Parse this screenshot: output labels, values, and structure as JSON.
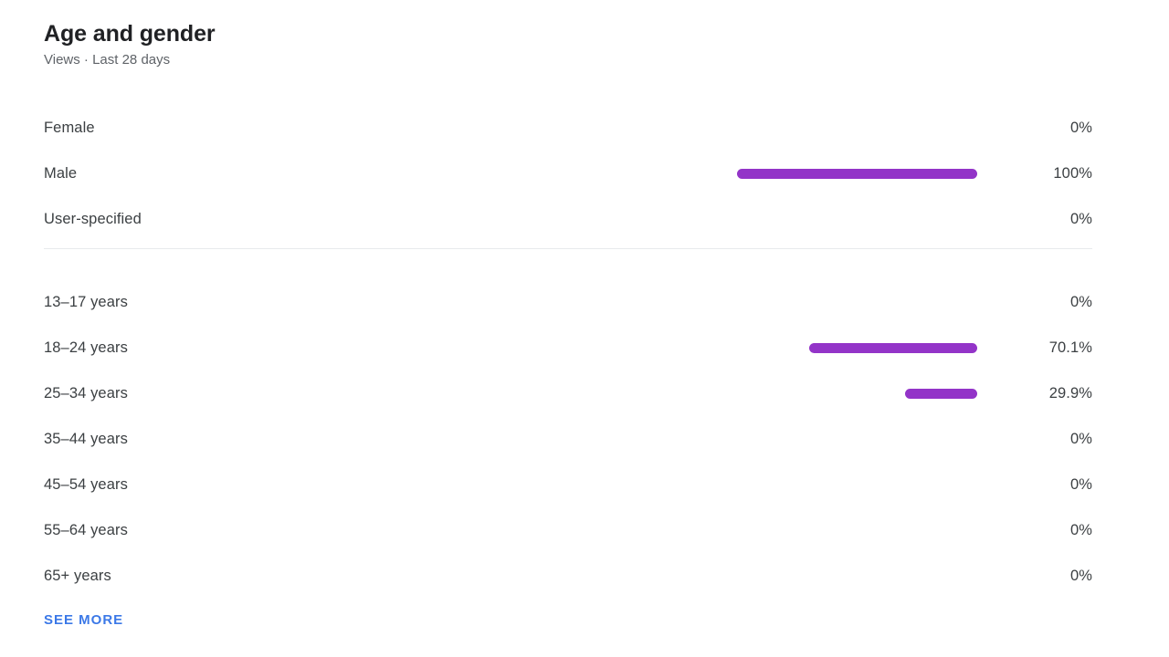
{
  "header": {
    "title": "Age and gender",
    "subtitle": "Views · Last 28 days"
  },
  "footer": {
    "see_more_label": "SEE MORE"
  },
  "colors": {
    "bar": "#9334c8",
    "link": "#3b78e7",
    "title_text": "#202124",
    "body_text": "#3c4043",
    "subtitle_text": "#5f6368",
    "divider": "#e8eaed"
  },
  "chart_data": {
    "type": "bar",
    "title": "Age and gender",
    "subtitle": "Views · Last 28 days",
    "metric": "Views",
    "period": "Last 28 days",
    "orientation": "horizontal",
    "bar_alignment": "right",
    "xlabel": "",
    "ylabel": "",
    "xlim": [
      0,
      100
    ],
    "grid": false,
    "legend": false,
    "value_unit": "%",
    "groups": [
      {
        "name": "gender",
        "categories": [
          "Female",
          "Male",
          "User-specified"
        ],
        "values": [
          0,
          100,
          0
        ],
        "value_labels": [
          "0%",
          "100%",
          "0%"
        ]
      },
      {
        "name": "age",
        "categories": [
          "13–17 years",
          "18–24 years",
          "25–34 years",
          "35–44 years",
          "45–54 years",
          "55–64 years",
          "65+ years"
        ],
        "values": [
          0,
          70.1,
          29.9,
          0,
          0,
          0,
          0
        ],
        "value_labels": [
          "0%",
          "70.1%",
          "29.9%",
          "0%",
          "0%",
          "0%",
          "0%"
        ]
      }
    ]
  }
}
